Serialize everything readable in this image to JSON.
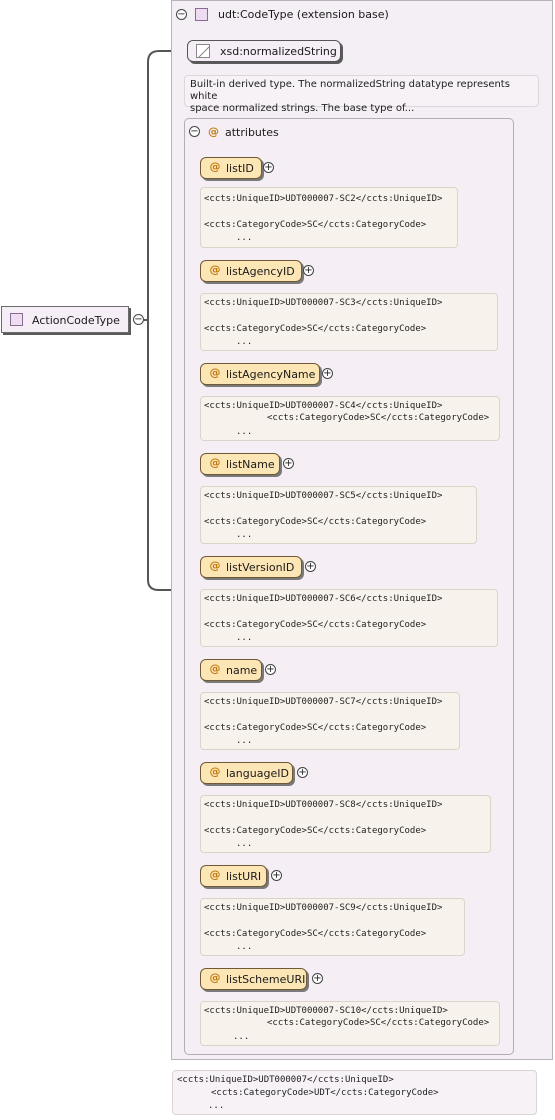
{
  "root": {
    "label": "ActionCodeType",
    "toggle": "−"
  },
  "extension": {
    "title": "udt:CodeType (extension base)",
    "toggle": "−"
  },
  "base": {
    "label": "xsd:normalizedString",
    "doc_line1": "Built-in derived type. The normalizedString datatype represents white",
    "doc_line2": "space normalized strings. The base type of..."
  },
  "attributes": {
    "title": "attributes",
    "at_symbol": "@",
    "toggle": "−",
    "items": [
      {
        "name": "listID",
        "toggle": "+",
        "doc": [
          "<ccts:UniqueID>UDT000007-SC2</ccts:UniqueID>",
          "",
          "<ccts:CategoryCode>SC</ccts:CategoryCode>",
          "..."
        ]
      },
      {
        "name": "listAgencyID",
        "toggle": "+",
        "doc": [
          "<ccts:UniqueID>UDT000007-SC3</ccts:UniqueID>",
          "",
          "<ccts:CategoryCode>SC</ccts:CategoryCode>",
          "..."
        ]
      },
      {
        "name": "listAgencyName",
        "toggle": "+",
        "doc": [
          "<ccts:UniqueID>UDT000007-SC4</ccts:UniqueID>",
          "<ccts:CategoryCode>SC</ccts:CategoryCode>",
          "..."
        ]
      },
      {
        "name": "listName",
        "toggle": "+",
        "doc": [
          "<ccts:UniqueID>UDT000007-SC5</ccts:UniqueID>",
          "",
          "<ccts:CategoryCode>SC</ccts:CategoryCode>",
          "..."
        ]
      },
      {
        "name": "listVersionID",
        "toggle": "+",
        "doc": [
          "<ccts:UniqueID>UDT000007-SC6</ccts:UniqueID>",
          "",
          "<ccts:CategoryCode>SC</ccts:CategoryCode>",
          "..."
        ]
      },
      {
        "name": "name",
        "toggle": "+",
        "doc": [
          "<ccts:UniqueID>UDT000007-SC7</ccts:UniqueID>",
          "",
          "<ccts:CategoryCode>SC</ccts:CategoryCode>",
          "..."
        ]
      },
      {
        "name": "languageID",
        "toggle": "+",
        "doc": [
          "<ccts:UniqueID>UDT000007-SC8</ccts:UniqueID>",
          "",
          "<ccts:CategoryCode>SC</ccts:CategoryCode>",
          "..."
        ]
      },
      {
        "name": "listURI",
        "toggle": "+",
        "doc": [
          "<ccts:UniqueID>UDT000007-SC9</ccts:UniqueID>",
          "",
          "<ccts:CategoryCode>SC</ccts:CategoryCode>",
          "..."
        ]
      },
      {
        "name": "listSchemeURI",
        "toggle": "+",
        "doc": [
          "<ccts:UniqueID>UDT000007-SC10</ccts:UniqueID>",
          "<ccts:CategoryCode>SC</ccts:CategoryCode>",
          "..."
        ]
      }
    ]
  },
  "type_doc": [
    "<ccts:UniqueID>UDT000007</ccts:UniqueID>",
    "<ccts:CategoryCode>UDT</ccts:CategoryCode>",
    "..."
  ]
}
